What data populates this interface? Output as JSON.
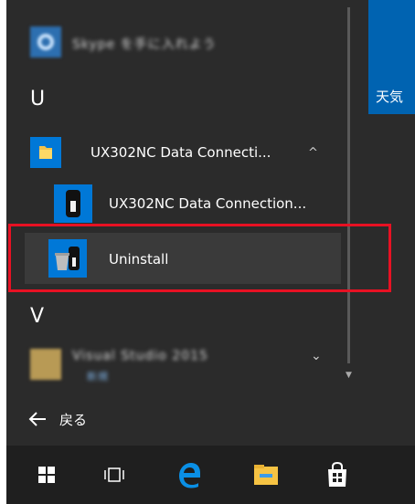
{
  "start_menu": {
    "blurred_top_item": "Skype を手に入れよう",
    "section_u": "U",
    "folder_item": {
      "label": "UX302NC Data Connecti...",
      "expand_glyph": "^"
    },
    "children": [
      {
        "label": "UX302NC Data Connection..."
      },
      {
        "label": "Uninstall"
      }
    ],
    "section_v": "V",
    "blurred_v_item": {
      "label": "Visual Studio 2015",
      "sublabel": "新規",
      "expand_glyph": "⌄"
    },
    "live_tile_text": "天気",
    "back_label": "戻る"
  },
  "taskbar": {
    "icons": [
      "windows-start-icon",
      "task-view-icon",
      "edge-icon",
      "file-explorer-icon",
      "store-icon"
    ]
  },
  "colors": {
    "menu_bg": "#2b2b2b",
    "accent": "#0078d7",
    "highlight_box": "#e81123",
    "taskbar_bg": "#1f1f1f"
  }
}
